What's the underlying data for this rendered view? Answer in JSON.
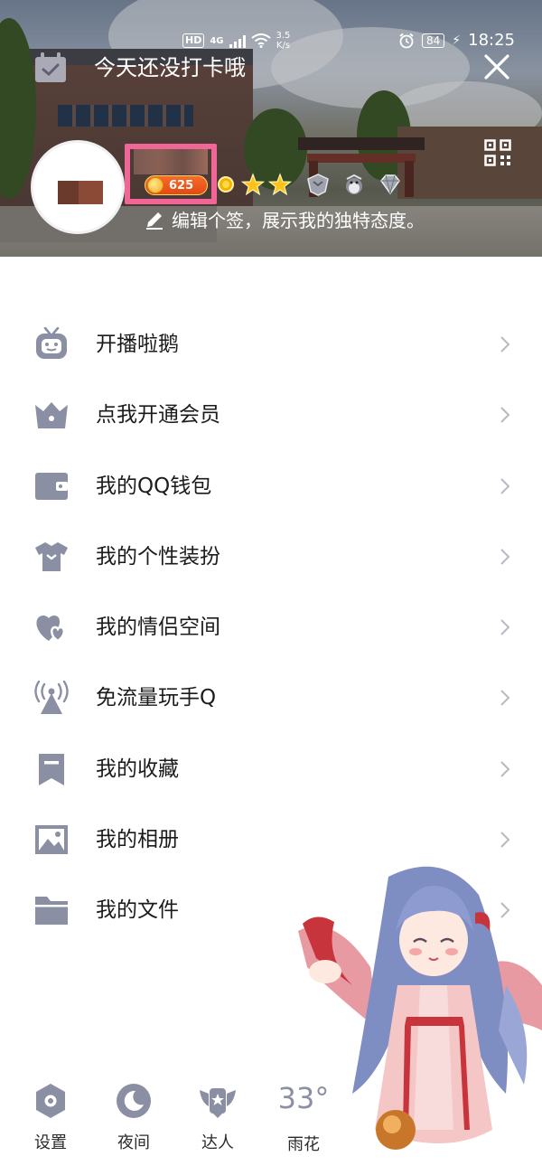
{
  "status_bar": {
    "hd": "HD",
    "network": "4G",
    "speed_value": "3.5",
    "speed_unit": "K/s",
    "battery": "84",
    "time": "18:25"
  },
  "header": {
    "checkin_text": "今天还没打卡哦",
    "coins": "625",
    "signature": "编辑个签，展示我的独特态度。"
  },
  "menu": {
    "items": [
      {
        "label": "开播啦鹅",
        "icon": "tv-robot-icon"
      },
      {
        "label": "点我开通会员",
        "icon": "crown-icon"
      },
      {
        "label": "我的QQ钱包",
        "icon": "wallet-icon"
      },
      {
        "label": "我的个性装扮",
        "icon": "tshirt-icon"
      },
      {
        "label": "我的情侣空间",
        "icon": "hearts-icon"
      },
      {
        "label": "免流量玩手Q",
        "icon": "antenna-icon"
      },
      {
        "label": "我的收藏",
        "icon": "bookmark-icon"
      },
      {
        "label": "我的相册",
        "icon": "photo-icon"
      },
      {
        "label": "我的文件",
        "icon": "folder-icon"
      }
    ]
  },
  "bottom_bar": {
    "settings": "设置",
    "night": "夜间",
    "expert": "达人",
    "temperature": "33°",
    "city": "雨花"
  },
  "colors": {
    "icon_gray": "#8a8fa3",
    "highlight_pink": "#f06797",
    "coin_orange": "#e24a12"
  }
}
